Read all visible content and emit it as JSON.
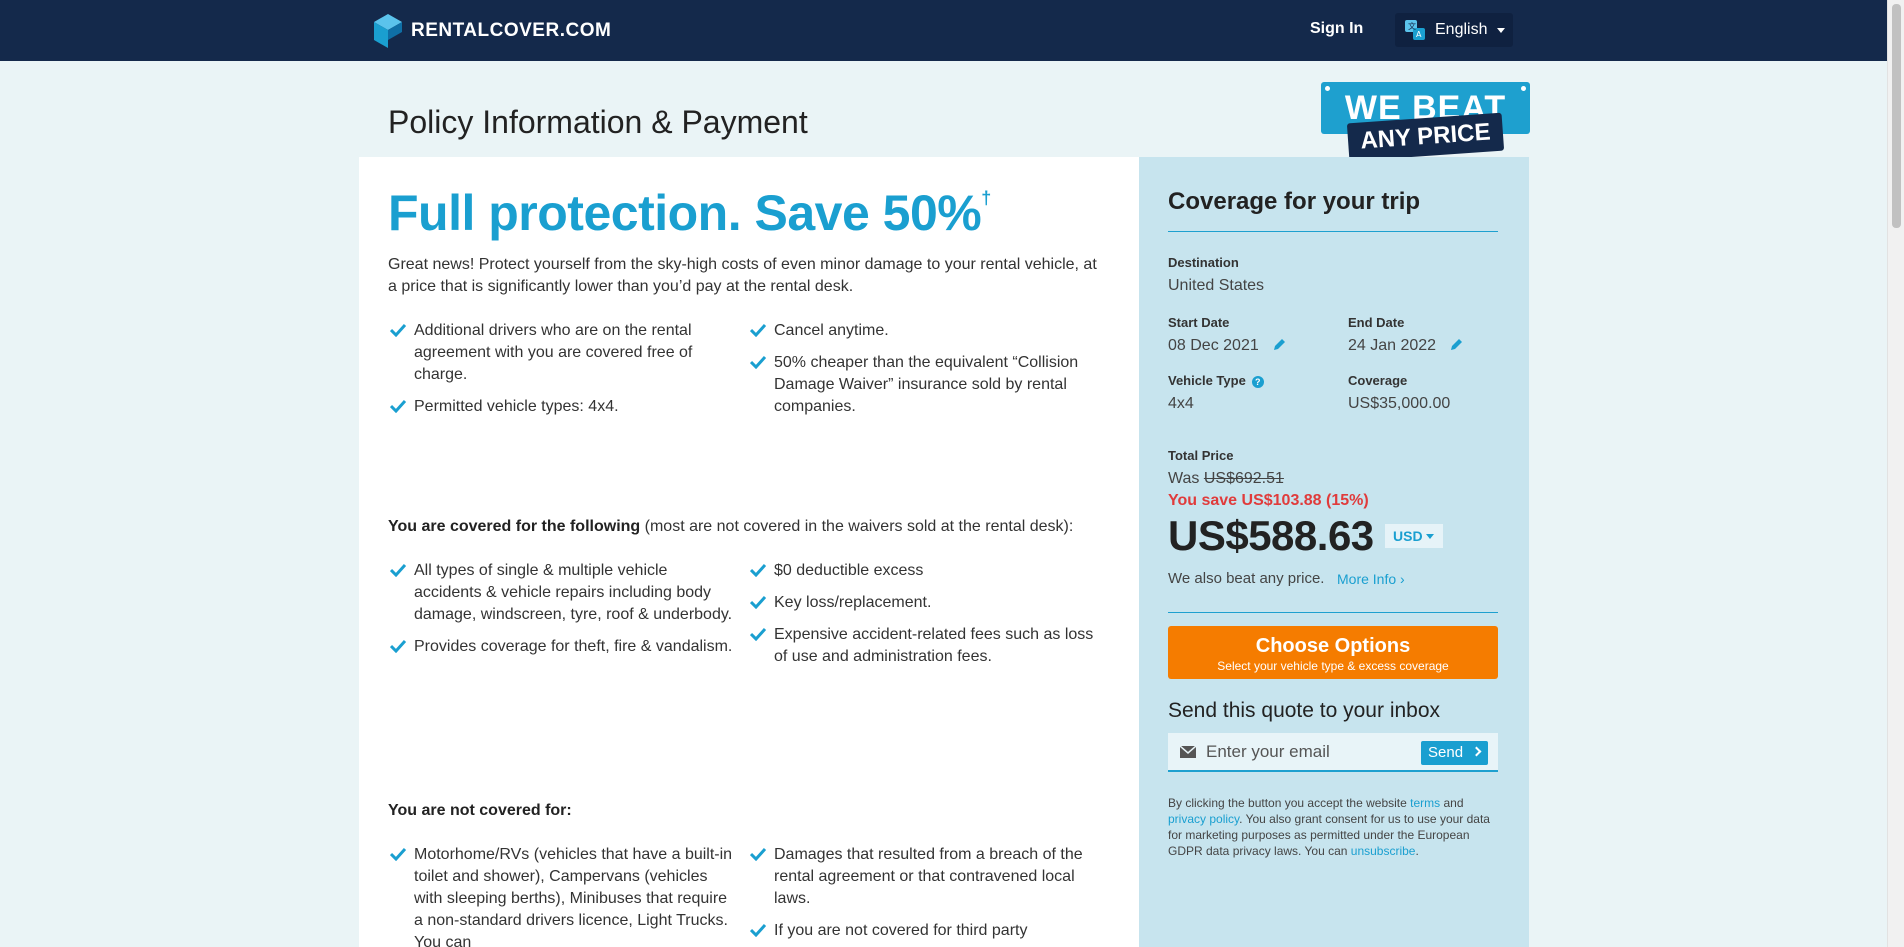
{
  "nav": {
    "logo_text": "RENTALCOVER.COM",
    "sign_in": "Sign In",
    "language": "English",
    "brand_color": "#14294b"
  },
  "page": {
    "title": "Policy Information & Payment",
    "badge_top": "WE BEAT",
    "badge_bottom": "ANY PRICE"
  },
  "hero": {
    "headline": "Full protection. Save 50%",
    "dagger": "†",
    "intro": "Great news! Protect yourself from the sky-high costs of even minor damage to your rental vehicle, at a price that is significantly lower than you’d pay at the rental desk."
  },
  "benefits": {
    "left": [
      "Additional drivers who are on the rental agreement with you are covered free of charge.",
      "Permitted vehicle types: 4x4."
    ],
    "right": [
      "Cancel anytime.",
      "50% cheaper than the equivalent “Collision Damage Waiver” insurance sold by rental companies."
    ]
  },
  "covered": {
    "heading_bold": "You are covered for the following",
    "heading_rest": " (most are not covered in the waivers sold at the rental desk):",
    "left": [
      "All types of single & multiple vehicle accidents & vehicle repairs including body damage, windscreen, tyre, roof & underbody.",
      "Provides coverage for theft, fire & vandalism."
    ],
    "right": [
      "$0 deductible excess",
      "Key loss/replacement.",
      "Expensive accident-related fees such as loss of use and administration fees."
    ]
  },
  "not_covered": {
    "heading": "You are not covered for:",
    "left": [
      "Motorhome/RVs (vehicles that have a built-in toilet and shower), Campervans (vehicles with sleeping berths), Minibuses that require a non-standard drivers licence, Light Trucks. You can"
    ],
    "right": [
      "Damages that resulted from a breach of the rental agreement or that contravened local laws.",
      "If you are not covered for third party"
    ]
  },
  "coverage": {
    "title": "Coverage for your trip",
    "destination_label": "Destination",
    "destination": "United States",
    "start_label": "Start Date",
    "start": "08 Dec 2021",
    "end_label": "End Date",
    "end": "24 Jan 2022",
    "vehicle_label": "Vehicle Type",
    "vehicle": "4x4",
    "coverage_label": "Coverage",
    "coverage": "US$35,000.00",
    "total_label": "Total Price",
    "was_prefix": "Was ",
    "was_price": "US$692.51",
    "you_save": "You save US$103.88 (15%)",
    "price": "US$588.63",
    "currency": "USD",
    "beat_text": "We also beat any price.",
    "more_info": "More Info ›",
    "choose_title": "Choose Options",
    "choose_sub": "Select your vehicle type & excess coverage",
    "send_heading": "Send this quote to your inbox",
    "email_placeholder": "Enter your email",
    "send_button": "Send",
    "legal_1": "By clicking the button you accept the website ",
    "legal_terms": "terms",
    "legal_2": " and ",
    "legal_privacy": "privacy policy",
    "legal_3": ". You also grant consent for us to use your data for marketing purposes as permitted under the European GDPR data privacy laws. You can ",
    "legal_unsub": "unsubscribe",
    "legal_4": "."
  },
  "colors": {
    "accent": "#1a9fd0",
    "cta": "#f57c00",
    "savings": "#e03b3b"
  }
}
